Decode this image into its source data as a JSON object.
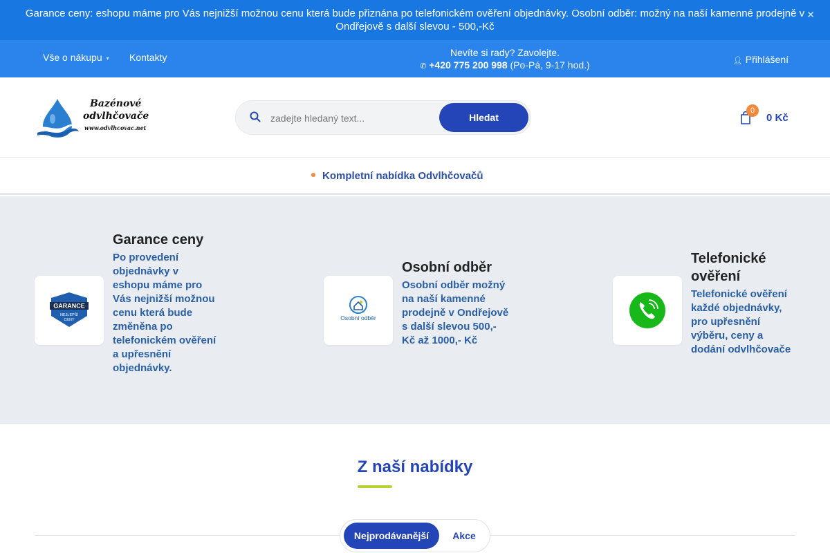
{
  "announcement": {
    "text": "Garance ceny: eshopu máme pro Vás nejnižší možnou cenu která bude přiznána po telefonickém ověření objednávky. Osobní odběr: možný na naší kamenné prodejně v Ondřejově s další slevou - 500,-Kč",
    "close_icon": "close-icon"
  },
  "topnav": {
    "links": [
      {
        "label": "Vše o nákupu",
        "has_dropdown": true
      },
      {
        "label": "Kontakty",
        "has_dropdown": false
      }
    ],
    "help_text": "Nevíte si rady? Zavolejte.",
    "phone": "+420 775 200 998",
    "hours": "(Po-Pá, 9-17 hod.)",
    "phone_icon": "phone-icon",
    "login": "Přihlášení",
    "login_icon": "user-icon"
  },
  "header": {
    "logo": {
      "line1": "Bazénové",
      "line2": "odvlhčovače",
      "line3": "www.odvlhcovac.net"
    },
    "search": {
      "placeholder": "zadejte hledaný text...",
      "button": "Hledat",
      "icon": "search-icon"
    },
    "cart": {
      "count": "0",
      "amount": "0 Kč",
      "icon": "shopping-bag-icon"
    }
  },
  "categories": {
    "item": "Kompletní nabídka Odvlhčovačů"
  },
  "features": [
    {
      "title": "Garance ceny",
      "text": "Po provedení objednávky v eshopu máme pro Vás nejnižší možnou cenu která bude změněna po telefonickém ověření a upřesnění objednávky.",
      "icon": "guarantee-badge-icon",
      "badge_lines": [
        "GARANCE",
        "NEJLEPŠÍ",
        "CENY"
      ]
    },
    {
      "title": "Osobní odběr",
      "text": "Osobní odběr možný na naší kamenné prodejně v Ondřejově s další slevou 500,-Kč až 1000,- Kč",
      "icon": "store-pickup-icon",
      "badge_lines": [
        "Osobní odběr"
      ]
    },
    {
      "title": "Telefonické ověření",
      "text": "Telefonické ověření každé objednávky, pro upřesnění výběru, ceny a dodání odvlhčovače",
      "icon": "phone-call-icon"
    }
  ],
  "offer": {
    "title": "Z naší nabídky",
    "tabs": [
      "Nejprodávanější",
      "Akce"
    ],
    "active_tab": "Nejprodávanější"
  },
  "colors": {
    "announcement_bg": "#1877e0",
    "nav_bg": "#2b84ec",
    "primary": "#2345b8",
    "accent_orange": "#f5883a",
    "accent_green": "#b3d335",
    "feature_text": "#2a5fa6",
    "features_bg": "#e9ecf1"
  }
}
